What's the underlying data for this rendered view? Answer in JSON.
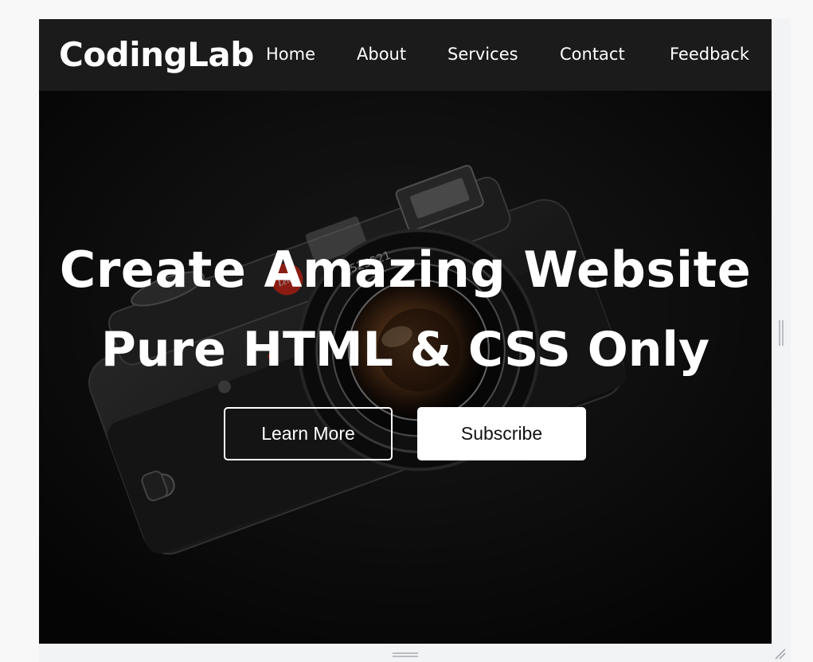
{
  "brand": {
    "logo_text": "CodingLab"
  },
  "nav": {
    "items": [
      {
        "label": "Home"
      },
      {
        "label": "About"
      },
      {
        "label": "Services"
      },
      {
        "label": "Contact"
      },
      {
        "label": "Feedback"
      }
    ]
  },
  "hero": {
    "title_line1": "Create Amazing Website",
    "title_line2": "Pure HTML & CSS Only",
    "learn_more_label": "Learn More",
    "subscribe_label": "Subscribe",
    "camera_brand_badge": "Leica",
    "lens_serial": "2525521"
  },
  "colors": {
    "navbar_bg": "#1b1b1b",
    "hero_bg": "#0d0d0d",
    "text": "#ffffff",
    "badge_red": "#d42b1e"
  }
}
